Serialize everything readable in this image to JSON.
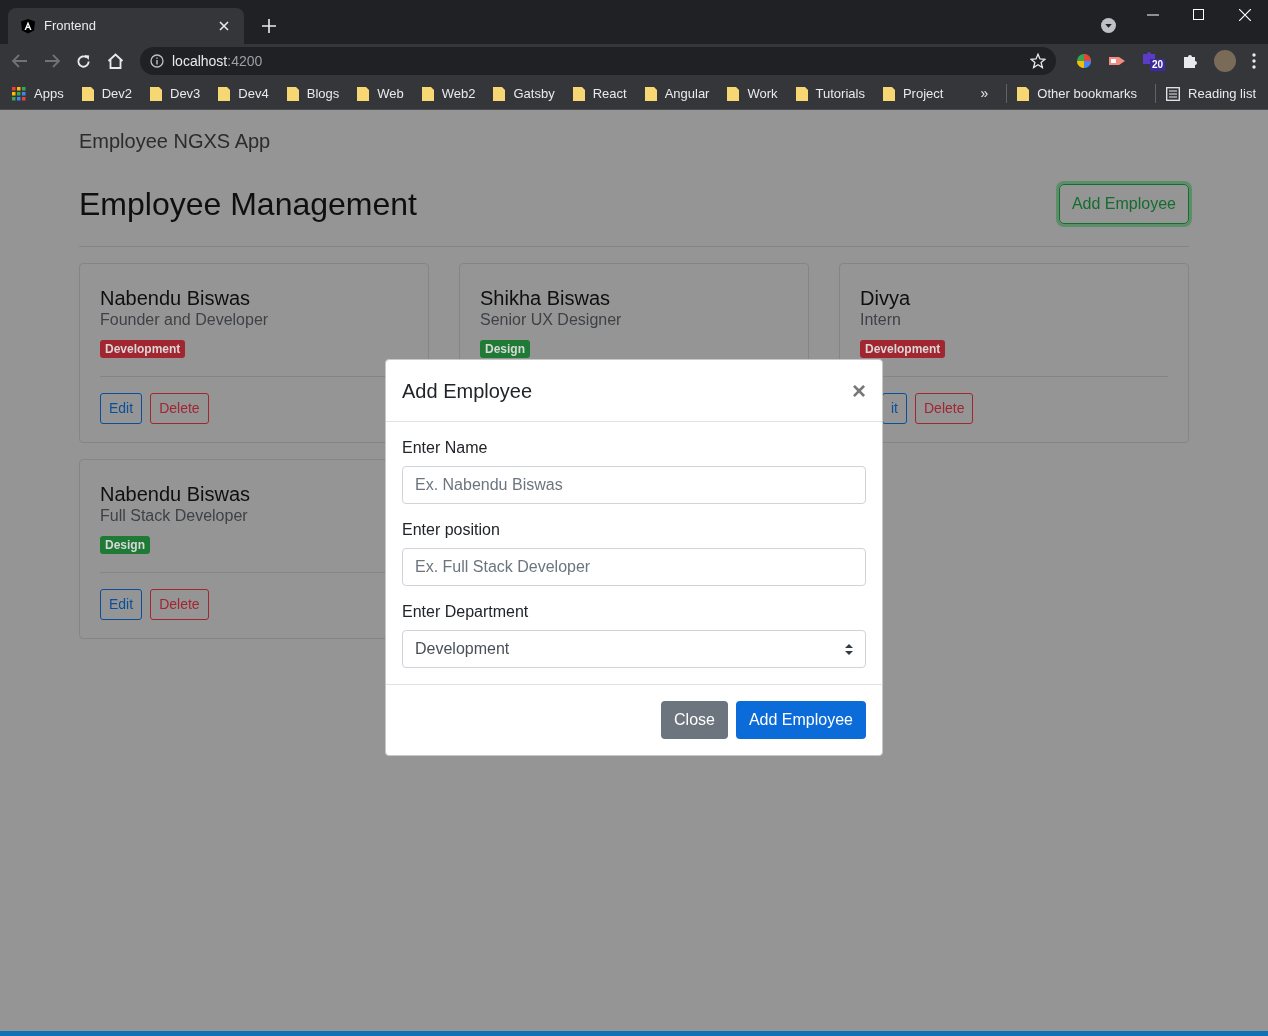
{
  "browser": {
    "tab": {
      "title": "Frontend"
    },
    "address": {
      "host": "localhost",
      "port": ":4200"
    },
    "extension_badge": "20",
    "bookmarks": [
      {
        "label": "Apps",
        "kind": "apps"
      },
      {
        "label": "Dev2",
        "kind": "folder"
      },
      {
        "label": "Dev3",
        "kind": "folder"
      },
      {
        "label": "Dev4",
        "kind": "folder"
      },
      {
        "label": "Blogs",
        "kind": "folder"
      },
      {
        "label": "Web",
        "kind": "folder"
      },
      {
        "label": "Web2",
        "kind": "folder"
      },
      {
        "label": "Gatsby",
        "kind": "folder"
      },
      {
        "label": "React",
        "kind": "folder"
      },
      {
        "label": "Angular",
        "kind": "folder"
      },
      {
        "label": "Work",
        "kind": "folder"
      },
      {
        "label": "Tutorials",
        "kind": "folder"
      },
      {
        "label": "Project",
        "kind": "folder"
      }
    ],
    "overflow": "»",
    "other_bookmarks": "Other bookmarks",
    "reading_list": "Reading list"
  },
  "navbar": {
    "brand": "Employee NGXS App"
  },
  "header": {
    "title": "Employee Management",
    "button": "Add Employee"
  },
  "cards": [
    {
      "name": "Nabendu Biswas",
      "position": "Founder and Developer",
      "department": {
        "label": "Development",
        "color": "#a2262f"
      },
      "buttons": [
        {
          "label": "Edit",
          "kind": "edit"
        },
        {
          "label": "Delete",
          "kind": "delete"
        }
      ]
    },
    {
      "name": "Shikha Biswas",
      "position": "Senior UX Designer",
      "department": {
        "label": "Design",
        "color": "#1e7a35"
      }
    },
    {
      "name": "Divya",
      "position": "Intern",
      "department": {
        "label": "Development",
        "color": "#a2262f"
      },
      "buttons": [
        {
          "label": "it",
          "kind": "edit"
        },
        {
          "label": "Delete",
          "kind": "delete"
        }
      ]
    },
    {
      "name": "Nabendu Biswas",
      "position": "Full Stack Developer",
      "department": {
        "label": "Design",
        "color": "#1e7a35"
      },
      "buttons": [
        {
          "label": "Edit",
          "kind": "edit"
        },
        {
          "label": "Delete",
          "kind": "delete"
        }
      ]
    }
  ],
  "modal": {
    "title": "Add Employee",
    "close": "×",
    "fields": [
      {
        "label": "Enter Name",
        "kind": "text",
        "placeholder": "Ex. Nabendu Biswas"
      },
      {
        "label": "Enter position",
        "kind": "text",
        "placeholder": "Ex. Full Stack Developer"
      },
      {
        "label": "Enter Department",
        "kind": "select",
        "value": "Development"
      }
    ],
    "buttons": [
      {
        "label": "Close",
        "kind": "secondary"
      },
      {
        "label": "Add Employee",
        "kind": "primary"
      }
    ]
  }
}
